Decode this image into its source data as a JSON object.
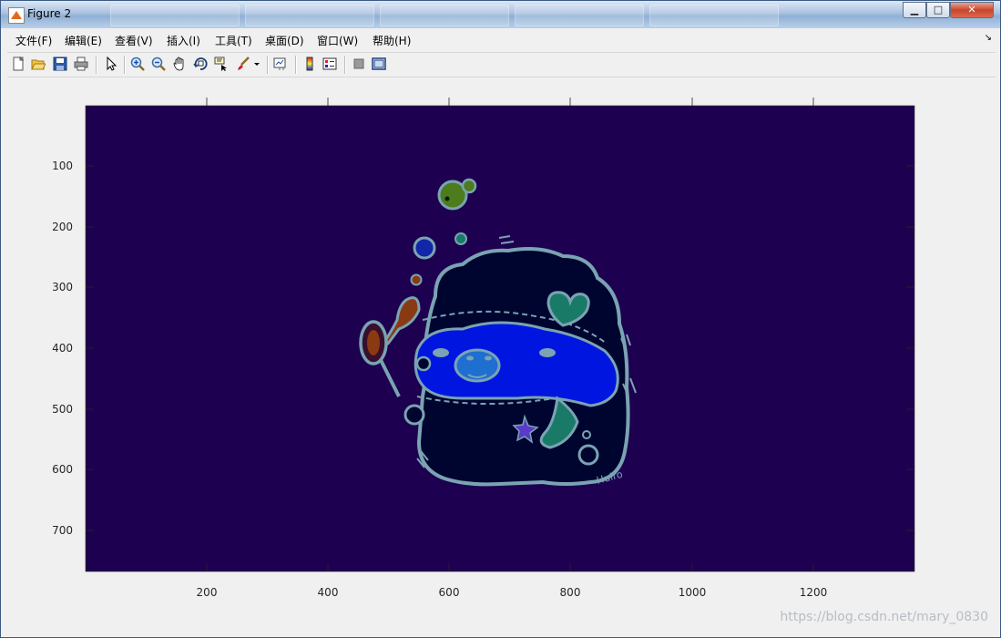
{
  "window": {
    "title": "Figure 2",
    "controls": {
      "minimize": "▁",
      "maximize": "□",
      "close": "✕"
    }
  },
  "menu": {
    "items": [
      {
        "label": "文件(F)"
      },
      {
        "label": "编辑(E)"
      },
      {
        "label": "查看(V)"
      },
      {
        "label": "插入(I)"
      },
      {
        "label": "工具(T)"
      },
      {
        "label": "桌面(D)"
      },
      {
        "label": "窗口(W)"
      },
      {
        "label": "帮助(H)"
      }
    ]
  },
  "toolbar": {
    "icons": [
      "new-figure-icon",
      "open-file-icon",
      "save-icon",
      "print-icon",
      "edit-plot-arrow-icon",
      "zoom-in-icon",
      "zoom-out-icon",
      "pan-hand-icon",
      "rotate-3d-icon",
      "data-cursor-icon",
      "brush-icon",
      "brush-dropdown-icon",
      "link-plot-icon",
      "colorbar-icon",
      "legend-icon",
      "hide-plot-tools-icon",
      "show-plot-tools-icon"
    ]
  },
  "axes": {
    "yticks": [
      "100",
      "200",
      "300",
      "400",
      "500",
      "600",
      "700"
    ],
    "xticks": [
      "200",
      "400",
      "600",
      "800",
      "1000",
      "1200"
    ]
  },
  "image": {
    "background": "#1e0050",
    "body": "#00052f",
    "face": "#0016e0",
    "outline": "#7aa3b3",
    "accent_green": "#4c7c1b",
    "accent_teal": "#1a7a68",
    "accent_brown": "#8a3a12",
    "signature": "Huiro"
  },
  "watermark": "https://blog.csdn.net/mary_0830"
}
